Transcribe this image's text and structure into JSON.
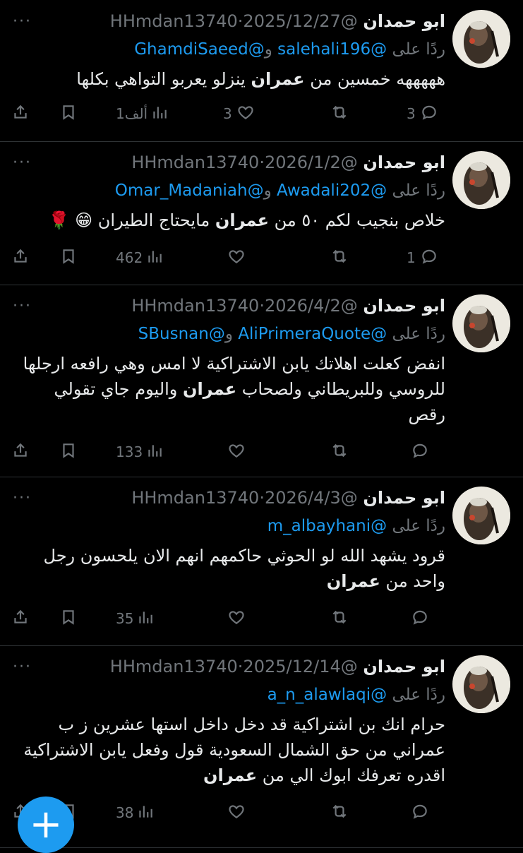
{
  "tweets": [
    {
      "name": "ابو حمدان",
      "handle": "@HHmdan13740",
      "sep": "·",
      "date": "2025/12/27",
      "reply_label": "ردًا على",
      "mention1": "@salehali196",
      "and": "و",
      "mention2": "@GhamdiSaeed",
      "text_parts": [
        "هههههه خمسين من ",
        "عمران",
        " ينزلو يعربو التواهي بكلها"
      ],
      "replies": "3",
      "retweets": "",
      "likes": "3",
      "views": "1ألف"
    },
    {
      "name": "ابو حمدان",
      "handle": "@HHmdan13740",
      "sep": "·",
      "date": "2026/1/2",
      "reply_label": "ردًا على",
      "mention1": "@Awadali202",
      "and": "و",
      "mention2": "@Omar_Madaniah",
      "text_parts": [
        "خلاص  بنجيب لكم ٥٠ من ",
        "عمران",
        " مايحتاج الطيران 😁 🌹"
      ],
      "replies": "1",
      "retweets": "",
      "likes": "",
      "views": "462"
    },
    {
      "name": "ابو حمدان",
      "handle": "@HHmdan13740",
      "sep": "·",
      "date": "2026/4/2",
      "reply_label": "ردًا على",
      "mention1": "@AliPrimeraQuote",
      "and": "و",
      "mention2": "@SBusnan",
      "text_parts": [
        "انفض كعلت اهلاتك يابن الاشتراكية لا امس وهي رافعه ارجلها للروسي وللبريطاني ولصحاب ",
        "عمران",
        " واليوم جاي تقولي رقص"
      ],
      "replies": "",
      "retweets": "",
      "likes": "",
      "views": "133"
    },
    {
      "name": "ابو حمدان",
      "handle": "@HHmdan13740",
      "sep": "·",
      "date": "2026/4/3",
      "reply_label": "ردًا على",
      "mention1": "@m_albayhani",
      "and": "",
      "mention2": "",
      "text_parts": [
        "قرود يشهد الله  لو الحوثي حاكمهم انهم الان يلحسون رجل واحد من ",
        "عمران",
        ""
      ],
      "replies": "",
      "retweets": "",
      "likes": "",
      "views": "35"
    },
    {
      "name": "ابو حمدان",
      "handle": "@HHmdan13740",
      "sep": "·",
      "date": "2025/12/14",
      "reply_label": "ردًا على",
      "mention1": "@a_n_alawlaqi",
      "and": "",
      "mention2": "",
      "text_parts": [
        "حرام انك بن اشتراكية قد دخل داخل استها عشرين  ز ب عمراني من حق الشمال السعودية قول وفعل يابن الاشتراكية  اقدره تعرفك ابوك الي من ",
        "عمران",
        ""
      ],
      "replies": "",
      "retweets": "",
      "likes": "",
      "views": "38"
    }
  ],
  "more_glyph": "···",
  "fab_label": "+",
  "icons": [
    "reply-icon",
    "retweet-icon",
    "like-icon",
    "views-icon",
    "bookmark-icon",
    "share-icon",
    "more-icon",
    "compose-icon"
  ],
  "colors": {
    "background": "#000000",
    "text": "#e7e9ea",
    "muted": "#71767b",
    "accent": "#1d9bf0",
    "divider": "#2f3336"
  }
}
